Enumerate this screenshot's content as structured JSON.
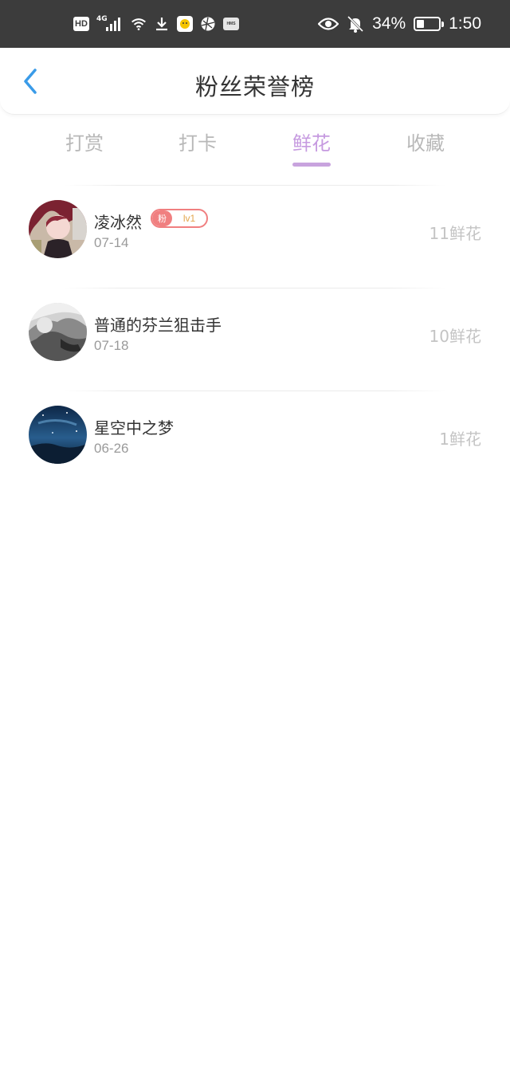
{
  "status_bar": {
    "hd": "HD",
    "network": "4G",
    "hms": "HMS",
    "battery_percent": "34%",
    "battery_level": 0.34,
    "time": "1:50",
    "icons": [
      "hd-icon",
      "signal-icon",
      "wifi-icon",
      "download-icon",
      "app-notification-icon",
      "browser-icon",
      "hms-icon",
      "eye-icon",
      "bell-mute-icon",
      "battery-icon"
    ]
  },
  "header": {
    "title": "粉丝荣誉榜",
    "back_icon": "chevron-left-icon"
  },
  "tabs": [
    {
      "label": "打赏",
      "active": false
    },
    {
      "label": "打卡",
      "active": false
    },
    {
      "label": "鲜花",
      "active": true
    },
    {
      "label": "收藏",
      "active": false
    }
  ],
  "list": [
    {
      "name": "凌冰然",
      "date": "07-14",
      "count": "11鲜花",
      "badge": {
        "left": "粉",
        "right": "lv1"
      }
    },
    {
      "name": "普通的芬兰狙击手",
      "date": "07-18",
      "count": "10鲜花"
    },
    {
      "name": "星空中之梦",
      "date": "06-26",
      "count": "1鲜花"
    }
  ],
  "colors": {
    "status_bar": "#3c3c3c",
    "accent": "#c69ae0",
    "back_arrow": "#3a9be8",
    "badge": "#f07f80"
  }
}
